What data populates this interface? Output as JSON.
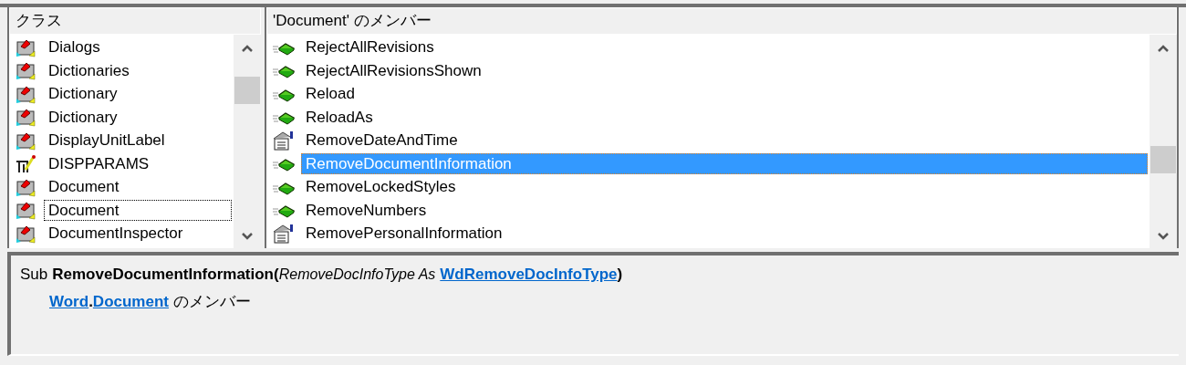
{
  "classes": {
    "header": "クラス",
    "items": [
      {
        "label": "Dialogs",
        "kind": "class",
        "focused": false
      },
      {
        "label": "Dictionaries",
        "kind": "class",
        "focused": false
      },
      {
        "label": "Dictionary",
        "kind": "class",
        "focused": false
      },
      {
        "label": "Dictionary",
        "kind": "class",
        "focused": false
      },
      {
        "label": "DisplayUnitLabel",
        "kind": "class",
        "focused": false
      },
      {
        "label": "DISPPARAMS",
        "kind": "type",
        "focused": false
      },
      {
        "label": "Document",
        "kind": "class",
        "focused": false
      },
      {
        "label": "Document",
        "kind": "class",
        "focused": true
      },
      {
        "label": "DocumentInspector",
        "kind": "class",
        "focused": false
      }
    ]
  },
  "members": {
    "header": "'Document' のメンバー",
    "items": [
      {
        "label": "RejectAllRevisions",
        "kind": "method",
        "selected": false
      },
      {
        "label": "RejectAllRevisionsShown",
        "kind": "method",
        "selected": false
      },
      {
        "label": "Reload",
        "kind": "method",
        "selected": false
      },
      {
        "label": "ReloadAs",
        "kind": "method",
        "selected": false
      },
      {
        "label": "RemoveDateAndTime",
        "kind": "property",
        "selected": false
      },
      {
        "label": "RemoveDocumentInformation",
        "kind": "method",
        "selected": true
      },
      {
        "label": "RemoveLockedStyles",
        "kind": "method",
        "selected": false
      },
      {
        "label": "RemoveNumbers",
        "kind": "method",
        "selected": false
      },
      {
        "label": "RemovePersonalInformation",
        "kind": "property",
        "selected": false
      }
    ]
  },
  "details": {
    "lines": [
      [
        {
          "text": "Sub",
          "kind": "keyword"
        },
        {
          "text": "RemoveDocumentInformation(",
          "kind": "name"
        },
        {
          "text": "RemoveDocInfoType As",
          "kind": "parameter"
        },
        {
          "text": "WdRemoveDocInfoType",
          "kind": "link"
        },
        {
          "text": ")",
          "kind": "name"
        }
      ],
      [
        {
          "text": "Word",
          "kind": "link"
        },
        {
          "text": ".",
          "kind": "name"
        },
        {
          "text": "Document",
          "kind": "link"
        },
        {
          "text": "のメンバー",
          "kind": "keyword"
        }
      ]
    ]
  }
}
